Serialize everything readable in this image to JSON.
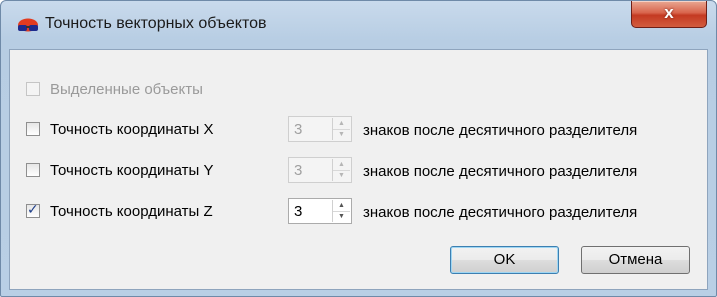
{
  "window": {
    "title": "Точность векторных объектов",
    "close_label": "x"
  },
  "options": {
    "selected_only": {
      "label": "Выделенные объекты",
      "checked": false,
      "enabled": false
    },
    "x": {
      "label": "Точность координаты X",
      "checked": false,
      "value": "3",
      "enabled": false
    },
    "y": {
      "label": "Точность координаты Y",
      "checked": false,
      "value": "3",
      "enabled": false
    },
    "z": {
      "label": "Точность координаты Z",
      "checked": true,
      "value": "3",
      "enabled": true
    },
    "suffix": "знаков после десятичного разделителя"
  },
  "buttons": {
    "ok": "OK",
    "cancel": "Отмена"
  },
  "colors": {
    "title_bar": "#b9cfe5",
    "close_button": "#c43a22",
    "client_bg": "#f0f0f0"
  }
}
